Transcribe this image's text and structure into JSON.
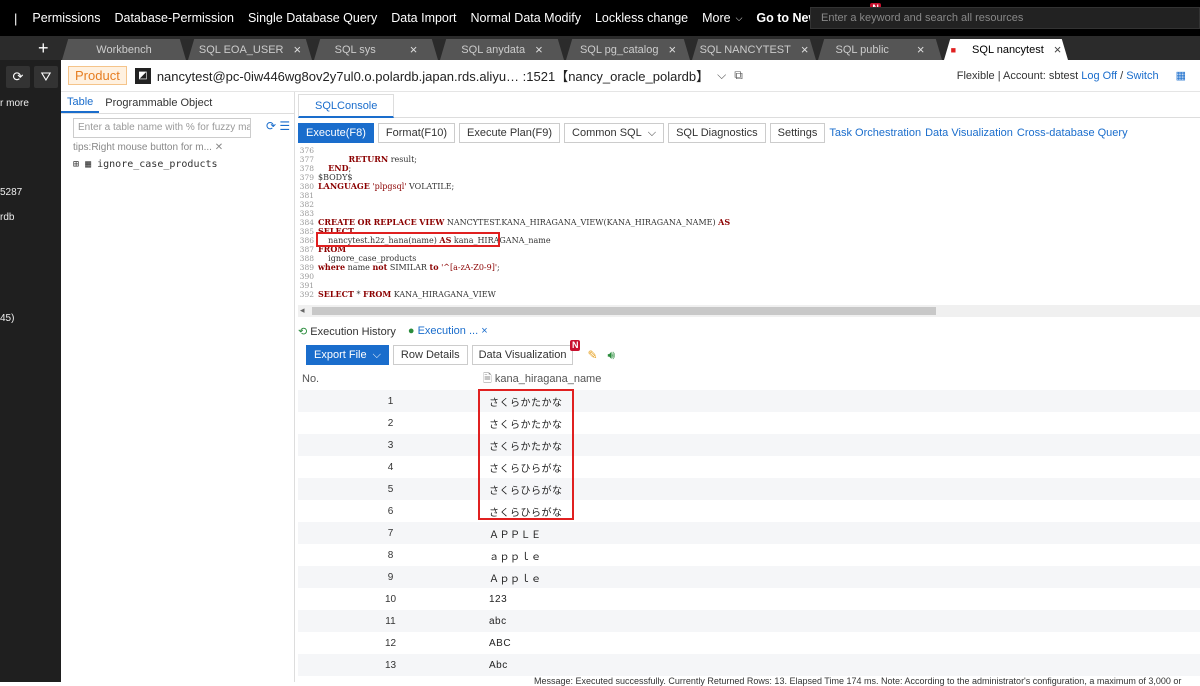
{
  "topbar": {
    "separator": "|",
    "menu": [
      "Permissions",
      "Database-Permission",
      "Single Database Query",
      "Data Import",
      "Normal Data Modify",
      "Lockless change",
      "More"
    ],
    "new_version": "Go to New Version",
    "new_badge": "N",
    "search_placeholder": "Enter a keyword and search all resources"
  },
  "tabs": [
    {
      "label": "Workbench"
    },
    {
      "label": "SQL EOA_USER"
    },
    {
      "label": "SQL sys"
    },
    {
      "label": "SQL anydata"
    },
    {
      "label": "SQL pg_catalog"
    },
    {
      "label": "SQL NANCYTEST"
    },
    {
      "label": "SQL public"
    },
    {
      "label": "SQL nancytest"
    }
  ],
  "leftbar": {
    "more": "r more",
    "t1": "5287",
    "t2": "rdb",
    "t3": "45)"
  },
  "header": {
    "env": "Product",
    "connection": "nancytest@pc-0iw446wg8ov2y7ul0.o.polardb.japan.rds.aliyu… :1521【nancy_oracle_polardb】",
    "mode": "Flexible | Account: sbtest",
    "logoff": "Log Off",
    "slash": "/",
    "switch": "Switch"
  },
  "left_panel": {
    "tab_table": "Table",
    "tab_prog": "Programmable Object",
    "search_placeholder": "Enter a table name with % for fuzzy match",
    "tips": "tips:Right mouse button for m...",
    "tree_item": "ignore_case_products"
  },
  "console": {
    "tab": "SQLConsole",
    "toolbar": {
      "execute": "Execute(F8)",
      "format": "Format(F10)",
      "plan": "Execute Plan(F9)",
      "common": "Common SQL",
      "diag": "SQL Diagnostics",
      "settings": "Settings",
      "task": "Task Orchestration",
      "dataviz": "Data Visualization",
      "crossdb": "Cross-database Query"
    }
  },
  "code_lines": [
    {
      "n": "376",
      "t": ""
    },
    {
      "n": "377",
      "t": "            RETURN result;"
    },
    {
      "n": "378",
      "t": "    END;"
    },
    {
      "n": "379",
      "t": "$BODY$"
    },
    {
      "n": "380",
      "t": "LANGUAGE 'plpgsql' VOLATILE;"
    },
    {
      "n": "381",
      "t": ""
    },
    {
      "n": "382",
      "t": ""
    },
    {
      "n": "383",
      "t": ""
    },
    {
      "n": "384",
      "t": "CREATE OR REPLACE VIEW NANCYTEST.KANA_HIRAGANA_VIEW(KANA_HIRAGANA_NAME) AS"
    },
    {
      "n": "385",
      "t": "SELECT"
    },
    {
      "n": "386",
      "t": "    nancytest.h2z_hana(name) AS kana_HIRAGANA_name"
    },
    {
      "n": "387",
      "t": "FROM"
    },
    {
      "n": "388",
      "t": "    ignore_case_products"
    },
    {
      "n": "389",
      "t": "where name not SIMILAR to '^[a-zA-Z0-9]';"
    },
    {
      "n": "390",
      "t": ""
    },
    {
      "n": "391",
      "t": ""
    },
    {
      "n": "392",
      "t": "SELECT * FROM KANA_HIRAGANA_VIEW"
    }
  ],
  "result": {
    "tab_history": "Execution History",
    "tab_exec": "Execution ...",
    "export": "Export File",
    "row_details": "Row Details",
    "dataviz": "Data Visualization",
    "col_no": "No.",
    "col_name": "kana_hiragana_name",
    "rows": [
      {
        "no": "1",
        "v": "さくらかたかな"
      },
      {
        "no": "2",
        "v": "さくらかたかな"
      },
      {
        "no": "3",
        "v": "さくらかたかな"
      },
      {
        "no": "4",
        "v": "さくらひらがな"
      },
      {
        "no": "5",
        "v": "さくらひらがな"
      },
      {
        "no": "6",
        "v": "さくらひらがな"
      },
      {
        "no": "7",
        "v": "ＡＰＰＬＥ"
      },
      {
        "no": "8",
        "v": "ａｐｐｌｅ"
      },
      {
        "no": "9",
        "v": "Ａｐｐｌｅ"
      },
      {
        "no": "10",
        "v": "123"
      },
      {
        "no": "11",
        "v": "abc"
      },
      {
        "no": "12",
        "v": "ABC"
      },
      {
        "no": "13",
        "v": "Abc"
      }
    ],
    "status": "Message: Executed successfully. Currently Returned Rows: 13. Elapsed Time 174 ms.    Note: According to the administrator's configuration, a maximum of 3,000 or"
  },
  "colors": {
    "accent": "#1a6dcc",
    "alert": "#e02020",
    "env": "#e67e22"
  }
}
